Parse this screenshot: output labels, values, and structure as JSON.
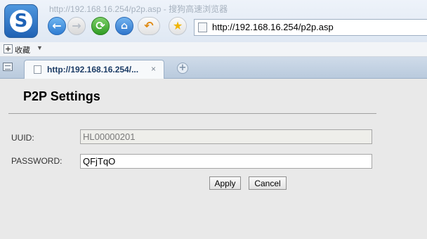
{
  "browser": {
    "window_title": "http://192.168.16.254/p2p.asp - 搜狗高速浏览器",
    "address_url": "http://192.168.16.254/p2p.asp",
    "bookmarks_label": "收藏",
    "tab_title": "http://192.168.16.254/...",
    "tab_close": "×",
    "new_tab": "+",
    "icons": {
      "back": "←",
      "forward": "→",
      "refresh": "⟳",
      "home": "⌂",
      "undo": "↶",
      "favorite": "★",
      "logo": "S"
    }
  },
  "page": {
    "title": "P2P Settings",
    "uuid_label": "UUID:",
    "uuid_value": "HL00000201",
    "password_label": "PASSWORD:",
    "password_value": "QFjTqO",
    "apply_label": "Apply",
    "cancel_label": "Cancel"
  }
}
